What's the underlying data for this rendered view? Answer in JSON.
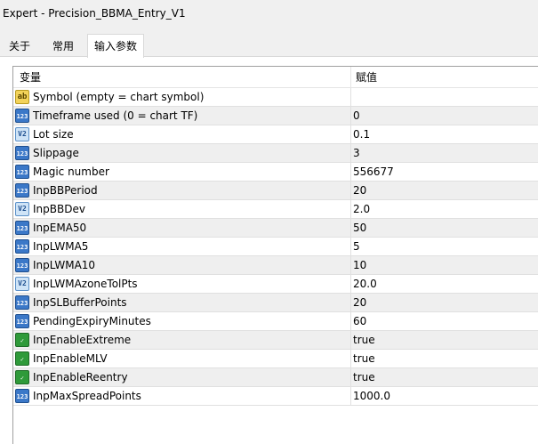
{
  "window": {
    "title": "Expert - Precision_BBMA_Entry_V1"
  },
  "tabs": [
    {
      "label": "关于"
    },
    {
      "label": "常用"
    },
    {
      "label": "输入参数",
      "active": true
    }
  ],
  "table": {
    "headers": {
      "name": "变量",
      "value": "赋值"
    },
    "rows": [
      {
        "type": "string",
        "icon": "string-type-icon",
        "icon_text": "ab",
        "name": "Symbol (empty = chart symbol)",
        "value": ""
      },
      {
        "type": "int",
        "icon": "integer-type-icon",
        "icon_text": "123",
        "name": "Timeframe used (0 = chart TF)",
        "value": "0"
      },
      {
        "type": "double",
        "icon": "double-type-icon",
        "icon_text": "V2",
        "name": "Lot size",
        "value": "0.1"
      },
      {
        "type": "int",
        "icon": "integer-type-icon",
        "icon_text": "123",
        "name": "Slippage",
        "value": "3"
      },
      {
        "type": "int",
        "icon": "integer-type-icon",
        "icon_text": "123",
        "name": "Magic number",
        "value": "556677"
      },
      {
        "type": "int",
        "icon": "integer-type-icon",
        "icon_text": "123",
        "name": "InpBBPeriod",
        "value": "20"
      },
      {
        "type": "double",
        "icon": "double-type-icon",
        "icon_text": "V2",
        "name": "InpBBDev",
        "value": "2.0"
      },
      {
        "type": "int",
        "icon": "integer-type-icon",
        "icon_text": "123",
        "name": "InpEMA50",
        "value": "50"
      },
      {
        "type": "int",
        "icon": "integer-type-icon",
        "icon_text": "123",
        "name": "InpLWMA5",
        "value": "5"
      },
      {
        "type": "int",
        "icon": "integer-type-icon",
        "icon_text": "123",
        "name": "InpLWMA10",
        "value": "10"
      },
      {
        "type": "double",
        "icon": "double-type-icon",
        "icon_text": "V2",
        "name": "InpLWMAzoneTolPts",
        "value": "20.0"
      },
      {
        "type": "int",
        "icon": "integer-type-icon",
        "icon_text": "123",
        "name": "InpSLBufferPoints",
        "value": "20"
      },
      {
        "type": "int",
        "icon": "integer-type-icon",
        "icon_text": "123",
        "name": "PendingExpiryMinutes",
        "value": "60"
      },
      {
        "type": "bool",
        "icon": "boolean-type-icon",
        "icon_text": "✓",
        "name": "InpEnableExtreme",
        "value": "true"
      },
      {
        "type": "bool",
        "icon": "boolean-type-icon",
        "icon_text": "✓",
        "name": "InpEnableMLV",
        "value": "true"
      },
      {
        "type": "bool",
        "icon": "boolean-type-icon",
        "icon_text": "✓",
        "name": "InpEnableReentry",
        "value": "true"
      },
      {
        "type": "int",
        "icon": "integer-type-icon",
        "icon_text": "123",
        "name": "InpMaxSpreadPoints",
        "value": "1000.0"
      }
    ]
  }
}
